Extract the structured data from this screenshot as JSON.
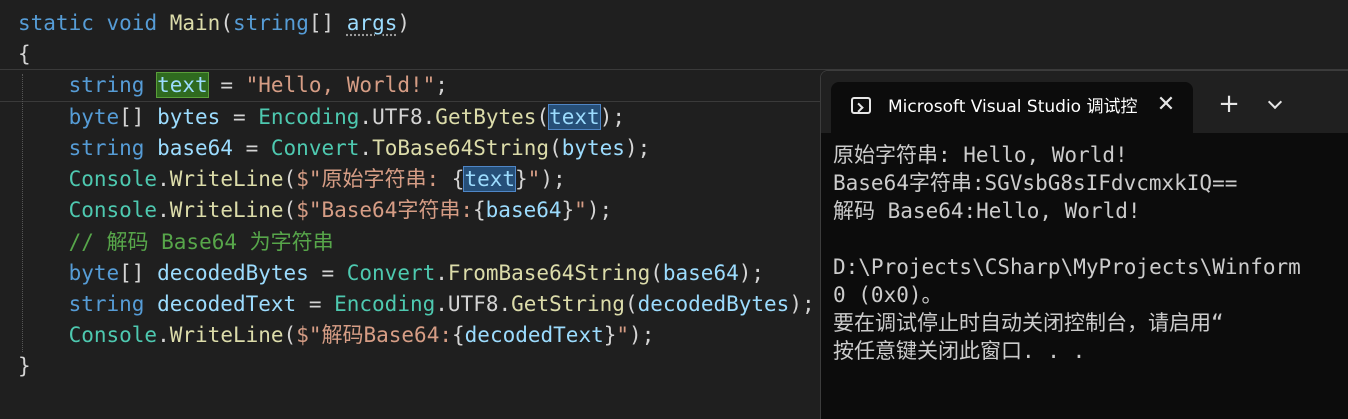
{
  "editor": {
    "code": [
      {
        "tokens": [
          {
            "c": "kw",
            "t": "static"
          },
          {
            "c": "pl",
            "t": " "
          },
          {
            "c": "kw",
            "t": "void"
          },
          {
            "c": "pl",
            "t": " "
          },
          {
            "c": "fn",
            "t": "Main"
          },
          {
            "c": "pl",
            "t": "("
          },
          {
            "c": "kw",
            "t": "string"
          },
          {
            "c": "pl",
            "t": "[] "
          },
          {
            "c": "var squiggle",
            "t": "args"
          },
          {
            "c": "pl",
            "t": ")"
          }
        ]
      },
      {
        "tokens": [
          {
            "c": "pl",
            "t": "{"
          }
        ]
      },
      {
        "tokens": [
          {
            "c": "pl",
            "t": "    "
          },
          {
            "c": "kw",
            "t": "string"
          },
          {
            "c": "pl",
            "t": " "
          },
          {
            "c": "var hl-green",
            "t": "text"
          },
          {
            "c": "pl",
            "t": " = "
          },
          {
            "c": "str",
            "t": "\"Hello, World!\""
          },
          {
            "c": "pl",
            "t": ";"
          }
        ]
      },
      {
        "tokens": [
          {
            "c": "pl",
            "t": "    "
          },
          {
            "c": "kw",
            "t": "byte"
          },
          {
            "c": "pl",
            "t": "[] "
          },
          {
            "c": "var",
            "t": "bytes"
          },
          {
            "c": "pl",
            "t": " = "
          },
          {
            "c": "ty",
            "t": "Encoding"
          },
          {
            "c": "pl",
            "t": "."
          },
          {
            "c": "pl",
            "t": "UTF8"
          },
          {
            "c": "pl",
            "t": "."
          },
          {
            "c": "fn",
            "t": "GetBytes"
          },
          {
            "c": "pl",
            "t": "("
          },
          {
            "c": "var hl-blue",
            "t": "text"
          },
          {
            "c": "pl",
            "t": ");"
          }
        ]
      },
      {
        "tokens": [
          {
            "c": "pl",
            "t": "    "
          },
          {
            "c": "kw",
            "t": "string"
          },
          {
            "c": "pl",
            "t": " "
          },
          {
            "c": "var",
            "t": "base64"
          },
          {
            "c": "pl",
            "t": " = "
          },
          {
            "c": "ty",
            "t": "Convert"
          },
          {
            "c": "pl",
            "t": "."
          },
          {
            "c": "fn",
            "t": "ToBase64String"
          },
          {
            "c": "pl",
            "t": "("
          },
          {
            "c": "var",
            "t": "bytes"
          },
          {
            "c": "pl",
            "t": ");"
          }
        ]
      },
      {
        "tokens": [
          {
            "c": "pl",
            "t": "    "
          },
          {
            "c": "ty",
            "t": "Console"
          },
          {
            "c": "pl",
            "t": "."
          },
          {
            "c": "fn",
            "t": "WriteLine"
          },
          {
            "c": "pl",
            "t": "("
          },
          {
            "c": "str",
            "t": "$\"原始字符串: "
          },
          {
            "c": "pl",
            "t": "{"
          },
          {
            "c": "var hl-blue",
            "t": "text"
          },
          {
            "c": "pl",
            "t": "}"
          },
          {
            "c": "str",
            "t": "\""
          },
          {
            "c": "pl",
            "t": ");"
          }
        ]
      },
      {
        "tokens": [
          {
            "c": "pl",
            "t": "    "
          },
          {
            "c": "ty",
            "t": "Console"
          },
          {
            "c": "pl",
            "t": "."
          },
          {
            "c": "fn",
            "t": "WriteLine"
          },
          {
            "c": "pl",
            "t": "("
          },
          {
            "c": "str",
            "t": "$\"Base64字符串:"
          },
          {
            "c": "pl",
            "t": "{"
          },
          {
            "c": "var",
            "t": "base64"
          },
          {
            "c": "pl",
            "t": "}"
          },
          {
            "c": "str",
            "t": "\""
          },
          {
            "c": "pl",
            "t": ");"
          }
        ]
      },
      {
        "tokens": [
          {
            "c": "pl",
            "t": "    "
          },
          {
            "c": "cm",
            "t": "// 解码 Base64 为字符串"
          }
        ]
      },
      {
        "tokens": [
          {
            "c": "pl",
            "t": "    "
          },
          {
            "c": "kw",
            "t": "byte"
          },
          {
            "c": "pl",
            "t": "[] "
          },
          {
            "c": "var",
            "t": "decodedBytes"
          },
          {
            "c": "pl",
            "t": " = "
          },
          {
            "c": "ty",
            "t": "Convert"
          },
          {
            "c": "pl",
            "t": "."
          },
          {
            "c": "fn",
            "t": "FromBase64String"
          },
          {
            "c": "pl",
            "t": "("
          },
          {
            "c": "var",
            "t": "base64"
          },
          {
            "c": "pl",
            "t": ");"
          }
        ]
      },
      {
        "tokens": [
          {
            "c": "pl",
            "t": "    "
          },
          {
            "c": "kw",
            "t": "string"
          },
          {
            "c": "pl",
            "t": " "
          },
          {
            "c": "var",
            "t": "decodedText"
          },
          {
            "c": "pl",
            "t": " = "
          },
          {
            "c": "ty",
            "t": "Encoding"
          },
          {
            "c": "pl",
            "t": "."
          },
          {
            "c": "pl",
            "t": "UTF8"
          },
          {
            "c": "pl",
            "t": "."
          },
          {
            "c": "fn",
            "t": "GetString"
          },
          {
            "c": "pl",
            "t": "("
          },
          {
            "c": "var",
            "t": "decodedBytes"
          },
          {
            "c": "pl",
            "t": ");"
          }
        ]
      },
      {
        "tokens": [
          {
            "c": "pl",
            "t": "    "
          },
          {
            "c": "ty",
            "t": "Console"
          },
          {
            "c": "pl",
            "t": "."
          },
          {
            "c": "fn",
            "t": "WriteLine"
          },
          {
            "c": "pl",
            "t": "("
          },
          {
            "c": "str",
            "t": "$\"解码Base64:"
          },
          {
            "c": "pl",
            "t": "{"
          },
          {
            "c": "var",
            "t": "decodedText"
          },
          {
            "c": "pl",
            "t": "}"
          },
          {
            "c": "str",
            "t": "\""
          },
          {
            "c": "pl",
            "t": ");"
          }
        ]
      },
      {
        "tokens": [
          {
            "c": "pl",
            "t": "}"
          }
        ]
      }
    ]
  },
  "console": {
    "tab_title": "Microsoft Visual Studio 调试控",
    "close_icon": "close-icon",
    "new_tab_icon": "plus-icon",
    "dropdown_icon": "chevron-down-icon",
    "new_tab_label": "+",
    "close_label": "✕",
    "output": [
      "原始字符串: Hello, World!",
      "Base64字符串:SGVsbG8sIFdvcmxkIQ==",
      "解码 Base64:Hello, World!",
      "",
      "D:\\Projects\\CSharp\\MyProjects\\Winform",
      "0 (0x0)。",
      "要在调试停止时自动关闭控制台，请启用“",
      "按任意键关闭此窗口. . ."
    ]
  }
}
